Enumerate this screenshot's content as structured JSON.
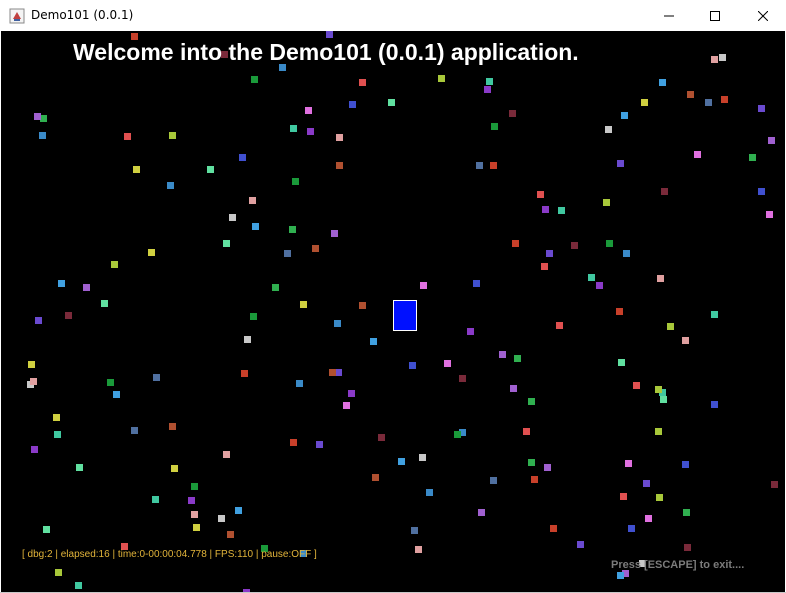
{
  "window": {
    "title": "Demo101 (0.0.1)",
    "icon": "java-cup-icon",
    "controls": [
      "minimize-icon",
      "maximize-icon",
      "close-icon"
    ]
  },
  "game": {
    "welcome_text": "Welcome into the Demo101 (0.0.1) application.",
    "debug_text": "[ dbg:2 | elapsed:16 | time:0-00:00:04.778 | FPS:110 | pause:OFF ]",
    "exit_hint": "Press [ESCAPE] to exit....",
    "colors": {
      "background": "#000000",
      "player": "#0010ff",
      "debug_text": "#e2b43a",
      "hint_text": "#7b7b7b"
    },
    "particle_colors": [
      "#c8402a",
      "#6a4ad0",
      "#7a2a3a",
      "#1a9a3a",
      "#3a8ac8",
      "#e05050",
      "#a8c83a",
      "#40c8a0",
      "#8a3ac8",
      "#e0a0a0",
      "#c8c8c8",
      "#40a0e0",
      "#a060d0",
      "#30b050",
      "#e070e0",
      "#4050d0",
      "#60e0a0",
      "#d0d040",
      "#b05030",
      "#5070a0"
    ]
  }
}
